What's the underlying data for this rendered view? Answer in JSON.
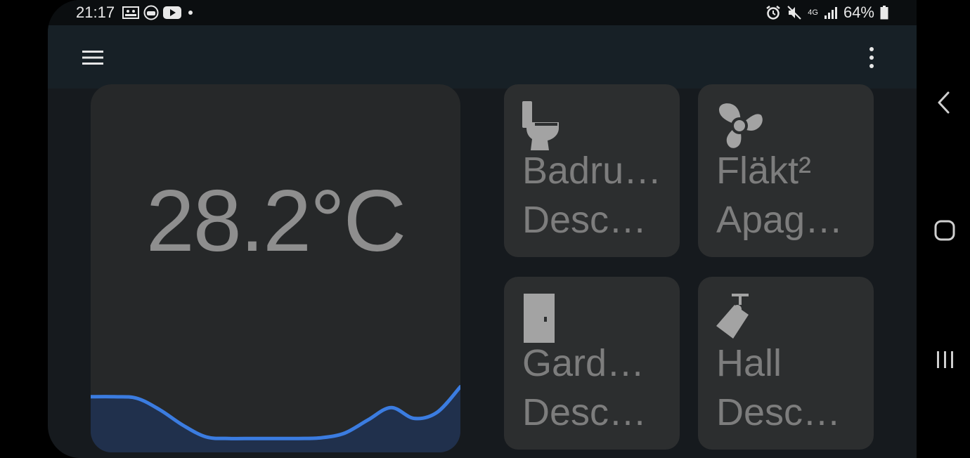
{
  "status": {
    "time": "21:17",
    "battery": "64%",
    "network": "4G",
    "left_icons": [
      "gallery-icon",
      "driving-icon",
      "youtube-icon",
      "dot-icon"
    ],
    "right_icons": [
      "alarm-icon",
      "mute-icon",
      "network-4g-icon",
      "signal-icon",
      "battery-icon"
    ]
  },
  "appbar": {
    "menu_icon": "hamburger-menu-icon",
    "more_icon": "more-vert-icon"
  },
  "sensor": {
    "value": "28.2°C",
    "graph_color": "#3b7ce0",
    "graph_fill": "#20304c",
    "trend": [
      0.72,
      0.72,
      0.7,
      0.55,
      0.35,
      0.2,
      0.18,
      0.18,
      0.18,
      0.18,
      0.19,
      0.25,
      0.42,
      0.58,
      0.44,
      0.52,
      0.85
    ]
  },
  "tiles": [
    {
      "name": "Badru…",
      "state": "Desc…",
      "icon": "toilet-icon"
    },
    {
      "name": "Fläkt²",
      "state": "Apag…",
      "icon": "fan-icon"
    },
    {
      "name": "Gard…",
      "state": "Desc…",
      "icon": "door-icon"
    },
    {
      "name": "Hall",
      "state": "Desc…",
      "icon": "ceiling-light-icon"
    }
  ],
  "nav": {
    "back": "back-icon",
    "home": "home-icon",
    "recents": "recents-icon"
  },
  "colors": {
    "background": "#161a1e",
    "appbar": "#172026",
    "card": "#262829",
    "tile": "#2c2e2f",
    "text_muted": "#7d7d7d"
  }
}
